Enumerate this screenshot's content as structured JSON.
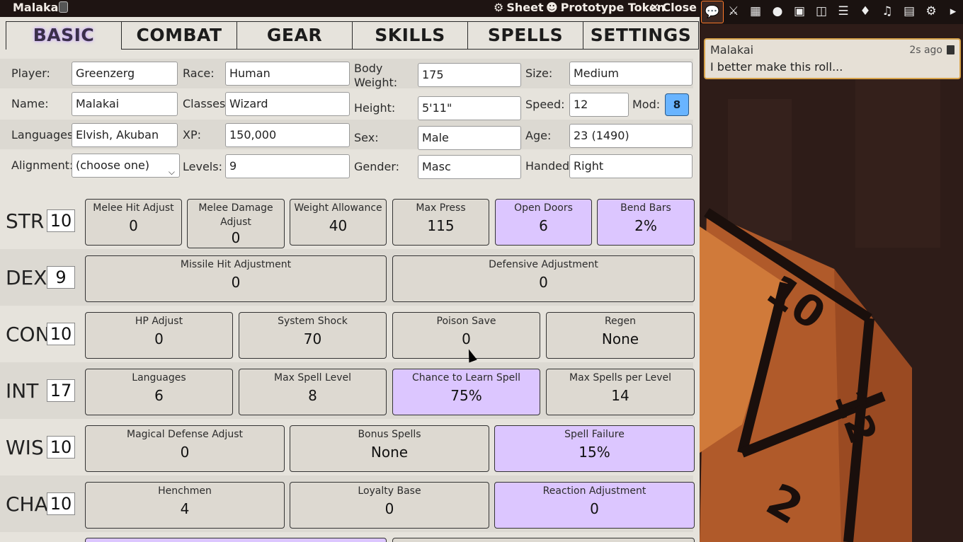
{
  "window": {
    "title": "Malakai",
    "sheet_label": "Sheet",
    "token_label": "Prototype Token",
    "close_label": "Close"
  },
  "tabs": [
    "BASIC",
    "COMBAT",
    "GEAR",
    "SKILLS",
    "SPELLS",
    "SETTINGS"
  ],
  "bio": {
    "player_label": "Player:",
    "player": "Greenzerg",
    "race_label": "Race:",
    "race": "Human",
    "weight_label": "Body Weight:",
    "weight": "175",
    "size_label": "Size:",
    "size": "Medium",
    "name_label": "Name:",
    "name": "Malakai",
    "classes_label": "Classes:",
    "classes": "Wizard",
    "height_label": "Height:",
    "height": "5'11\"",
    "speed_label": "Speed:",
    "speed": "12",
    "mod_label": "Mod:",
    "mod": "8",
    "languages_label": "Languages:",
    "languages": "Elvish, Akuban",
    "xp_label": "XP:",
    "xp": "150,000",
    "sex_label": "Sex:",
    "sex": "Male",
    "age_label": "Age:",
    "age": "23 (1490)",
    "alignment_label": "Alignment:",
    "alignment": "(choose one)",
    "levels_label": "Levels:",
    "levels": "9",
    "gender_label": "Gender:",
    "gender": "Masc",
    "handed_label": "Handed:",
    "handed": "Right"
  },
  "attributes": [
    {
      "abbr": "STR",
      "score": "10",
      "stats": [
        {
          "label": "Melee Hit Adjust",
          "value": "0"
        },
        {
          "label": "Melee Damage Adjust",
          "value": "0"
        },
        {
          "label": "Weight Allowance",
          "value": "40"
        },
        {
          "label": "Max Press",
          "value": "115"
        },
        {
          "label": "Open Doors",
          "value": "6",
          "highlight": true
        },
        {
          "label": "Bend Bars",
          "value": "2%",
          "highlight": true
        }
      ]
    },
    {
      "abbr": "DEX",
      "score": "9",
      "stats": [
        {
          "label": "Missile Hit Adjustment",
          "value": "0"
        },
        {
          "label": "Defensive Adjustment",
          "value": "0"
        }
      ]
    },
    {
      "abbr": "CON",
      "score": "10",
      "stats": [
        {
          "label": "HP Adjust",
          "value": "0"
        },
        {
          "label": "System Shock",
          "value": "70"
        },
        {
          "label": "Poison Save",
          "value": "0"
        },
        {
          "label": "Regen",
          "value": "None"
        }
      ]
    },
    {
      "abbr": "INT",
      "score": "17",
      "stats": [
        {
          "label": "Languages",
          "value": "6"
        },
        {
          "label": "Max Spell Level",
          "value": "8"
        },
        {
          "label": "Chance to Learn Spell",
          "value": "75%",
          "highlight": true
        },
        {
          "label": "Max Spells per Level",
          "value": "14"
        }
      ]
    },
    {
      "abbr": "WIS",
      "score": "10",
      "stats": [
        {
          "label": "Magical Defense Adjust",
          "value": "0"
        },
        {
          "label": "Bonus Spells",
          "value": "None"
        },
        {
          "label": "Spell Failure",
          "value": "15%",
          "highlight": true
        }
      ]
    },
    {
      "abbr": "CHA",
      "score": "10",
      "stats": [
        {
          "label": "Henchmen",
          "value": "4"
        },
        {
          "label": "Loyalty Base",
          "value": "0"
        },
        {
          "label": "Reaction Adjustment",
          "value": "0",
          "highlight": true
        }
      ]
    }
  ],
  "sidebar": {
    "icons": [
      "chat-icon",
      "combat-icon",
      "scenes-icon",
      "actors-icon",
      "items-icon",
      "journal-icon",
      "tables-icon",
      "cards-icon",
      "playlists-icon",
      "compendium-icon",
      "settings-icon",
      "collapse-icon"
    ]
  },
  "chat": {
    "speaker": "Malakai",
    "time": "2s ago",
    "message": "I better make this roll..."
  },
  "colors": {
    "highlight": "#dcc6ff",
    "mod_badge": "#69b4ff",
    "chat_border": "#d7a24a"
  }
}
